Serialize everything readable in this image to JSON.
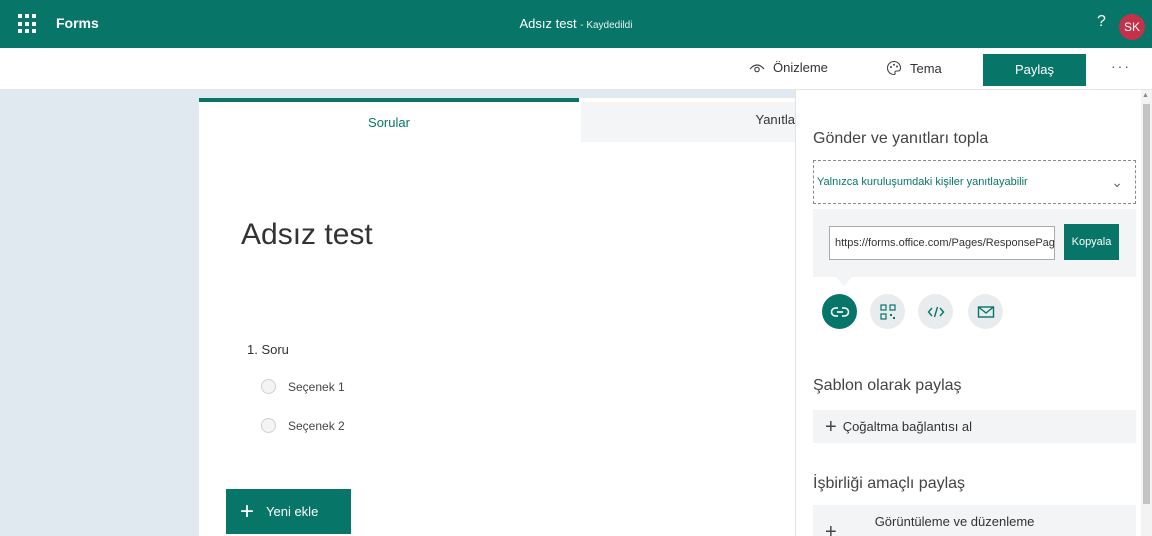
{
  "topbar": {
    "app_name": "Forms",
    "doc_title": "Adsız test",
    "save_status": "- Kaydedildi",
    "help": "?",
    "avatar_initials": "SK"
  },
  "commands": {
    "preview": "Önizleme",
    "theme": "Tema",
    "share": "Paylaş",
    "more": "···"
  },
  "tabs": {
    "questions": "Sorular",
    "responses": "Yanıtla"
  },
  "form": {
    "title": "Adsız test",
    "question_label": "1. Soru",
    "options": [
      "Seçenek 1",
      "Seçenek 2"
    ],
    "add_new": "Yeni ekle"
  },
  "panel": {
    "send_heading": "Gönder ve yanıtları topla",
    "audience": "Yalnızca kuruluşumdaki kişiler yanıtlayabilir",
    "link_value": "https://forms.office.com/Pages/ResponsePage.aspx",
    "copy": "Kopyala",
    "share_methods": [
      "link-icon",
      "qr-code-icon",
      "embed-code-icon",
      "email-icon"
    ],
    "template_heading": "Şablon olarak paylaş",
    "duplicate_link": "Çoğaltma bağlantısı al",
    "collab_heading": "İşbirliği amaçlı paylaş",
    "view_edit": "Görüntüleme ve düzenleme"
  },
  "colors": {
    "accent": "#077568",
    "avatar": "#c4314b",
    "background": "#dfe9ef"
  }
}
